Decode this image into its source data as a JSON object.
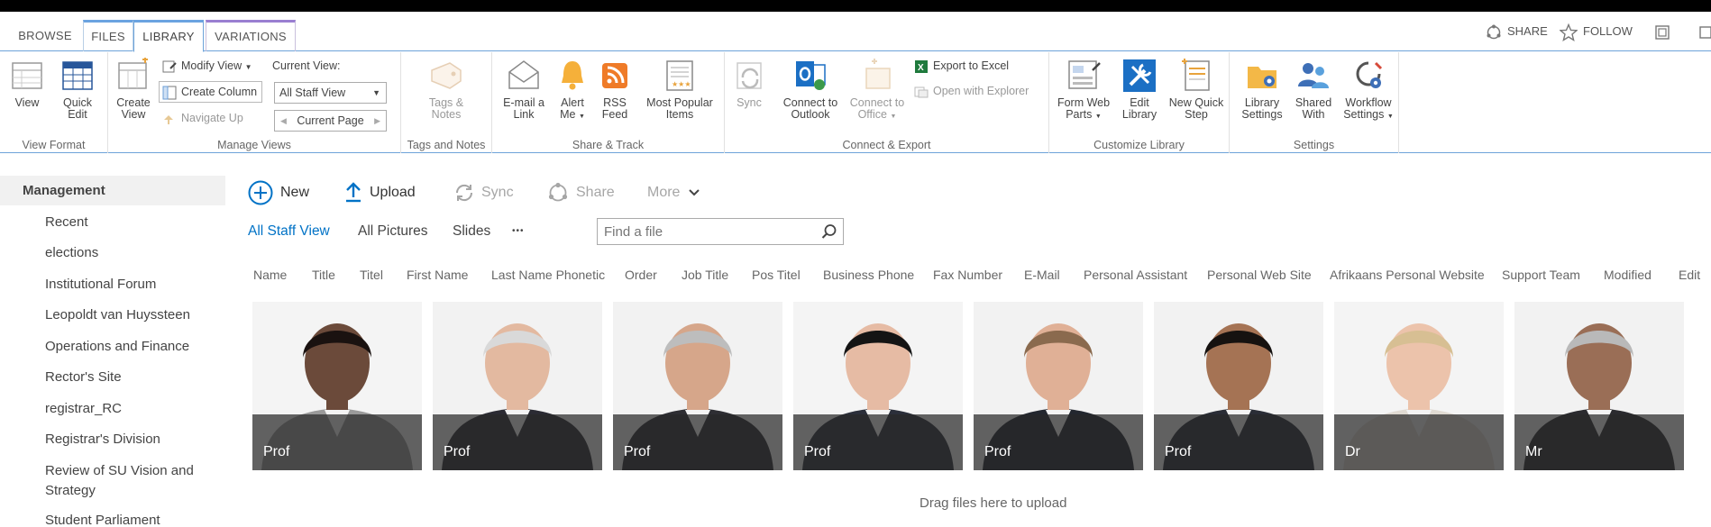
{
  "tabs": {
    "browse": "BROWSE",
    "files": "FILES",
    "library": "LIBRARY",
    "variations": "VARIATIONS"
  },
  "top_actions": {
    "share": "SHARE",
    "follow": "FOLLOW"
  },
  "ribbon": {
    "view_format": {
      "label": "View Format",
      "view": "View",
      "quick_edit_1": "Quick",
      "quick_edit_2": "Edit"
    },
    "manage_views": {
      "label": "Manage Views",
      "create_view_1": "Create",
      "create_view_2": "View",
      "modify_view": "Modify View",
      "create_column": "Create Column",
      "navigate_up": "Navigate Up",
      "current_view_label": "Current View:",
      "current_view_value": "All Staff View",
      "current_page": "Current Page"
    },
    "tags_notes": {
      "label": "Tags and Notes",
      "tags_1": "Tags &",
      "tags_2": "Notes"
    },
    "share_track": {
      "label": "Share & Track",
      "email_1": "E-mail a",
      "email_2": "Link",
      "alert_1": "Alert",
      "alert_2": "Me",
      "rss_1": "RSS",
      "rss_2": "Feed",
      "popular_1": "Most Popular",
      "popular_2": "Items"
    },
    "connect_export": {
      "label": "Connect & Export",
      "sync": "Sync",
      "outlook_1": "Connect to",
      "outlook_2": "Outlook",
      "office_1": "Connect to",
      "office_2": "Office",
      "export_excel": "Export to Excel",
      "open_explorer": "Open with Explorer"
    },
    "customize_library": {
      "label": "Customize Library",
      "form_web_1": "Form Web",
      "form_web_2": "Parts",
      "edit_lib_1": "Edit",
      "edit_lib_2": "Library",
      "quick_step_1": "New Quick",
      "quick_step_2": "Step"
    },
    "settings": {
      "label": "Settings",
      "lib_settings_1": "Library",
      "lib_settings_2": "Settings",
      "shared_1": "Shared",
      "shared_2": "With",
      "workflow_1": "Workflow",
      "workflow_2": "Settings"
    }
  },
  "leftnav": {
    "heading": "Management",
    "items": [
      "Recent",
      "elections",
      "Institutional Forum",
      "Leopoldt van Huyssteen",
      "Operations and Finance",
      "Rector's Site",
      "registrar_RC",
      "Registrar's Division",
      "Review of SU Vision and Strategy",
      "Student Parliament"
    ]
  },
  "commands": {
    "new": "New",
    "upload": "Upload",
    "sync": "Sync",
    "share": "Share",
    "more": "More"
  },
  "views": {
    "all_staff": "All Staff View",
    "all_pictures": "All Pictures",
    "slides": "Slides",
    "more": "•••"
  },
  "search": {
    "placeholder": "Find a file"
  },
  "columns": [
    "Name",
    "Title",
    "Titel",
    "First Name",
    "Last Name Phonetic",
    "Order",
    "Job Title",
    "Pos Titel",
    "Business Phone",
    "Fax Number",
    "E-Mail",
    "Personal Assistant",
    "Personal Web Site",
    "Afrikaans Personal Website",
    "Support Team",
    "Modified",
    "Edit"
  ],
  "tiles": [
    {
      "title": "Prof",
      "skin": "#6b4a3a",
      "hair": "#1a1210",
      "suit": "#9a9a9a",
      "bg": "#f4f4f4"
    },
    {
      "title": "Prof",
      "skin": "#e3b9a0",
      "hair": "#d9d9d9",
      "suit": "#2b2b33",
      "bg": "#f2f2f2"
    },
    {
      "title": "Prof",
      "skin": "#d6a68a",
      "hair": "#bdbdbd",
      "suit": "#2e2e33",
      "bg": "#f2f2f2"
    },
    {
      "title": "Prof",
      "skin": "#e6bba4",
      "hair": "#141414",
      "suit": "#2b2f3a",
      "bg": "#f4f4f4"
    },
    {
      "title": "Prof",
      "skin": "#e0b096",
      "hair": "#8a6a4e",
      "suit": "#23272f",
      "bg": "#f2f2f2"
    },
    {
      "title": "Prof",
      "skin": "#a57354",
      "hair": "#161210",
      "suit": "#2a2d36",
      "bg": "#f2f2f2"
    },
    {
      "title": "Dr",
      "skin": "#ecc3ab",
      "hair": "#d7bf93",
      "suit": "#e0dad2",
      "bg": "#f4f4f4"
    },
    {
      "title": "Mr",
      "skin": "#9a6e56",
      "hair": "#b9b9b9",
      "suit": "#2b2b2f",
      "bg": "#f2f2f2"
    }
  ],
  "drop_message": "Drag files here to upload"
}
